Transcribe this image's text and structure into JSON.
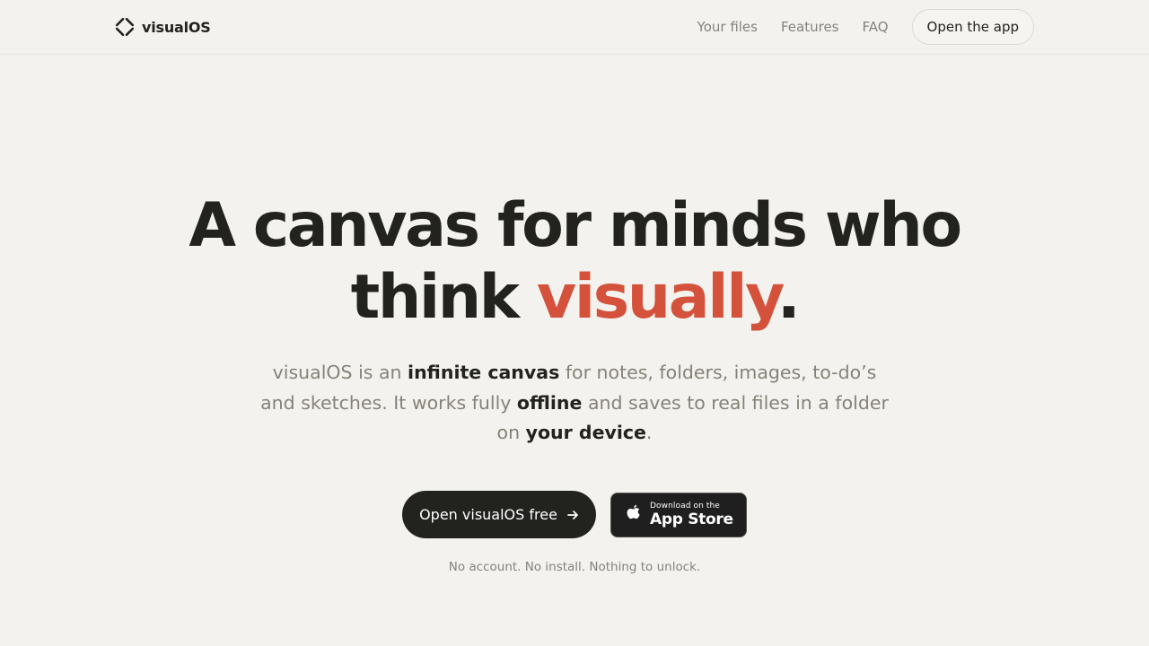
{
  "header": {
    "brand_name": "visualOS",
    "brand_icon": "visualos-logo-icon",
    "nav": [
      {
        "label": "Your files"
      },
      {
        "label": "Features"
      },
      {
        "label": "FAQ"
      }
    ],
    "open_app_label": "Open the app"
  },
  "hero": {
    "title_line1": "A canvas for minds who",
    "title_line2_pre": "think ",
    "title_accent": "visually",
    "title_end": ".",
    "accent_color": "#d4523b",
    "subtitle": {
      "p1": "visualOS is an ",
      "b1": "infinite canvas",
      "p2": " for notes, folders, images, to-do’s and sketches. It works fully ",
      "b2": "offline",
      "p3": " and saves to real files in a folder on ",
      "b3": "your device",
      "p4": "."
    },
    "primary_cta": {
      "label": "Open visualOS free",
      "icon": "arrow-right-icon"
    },
    "app_store": {
      "small": "Download on the",
      "big": "App Store",
      "icon": "apple-icon"
    },
    "note": "No account. No install. Nothing to unlock."
  }
}
